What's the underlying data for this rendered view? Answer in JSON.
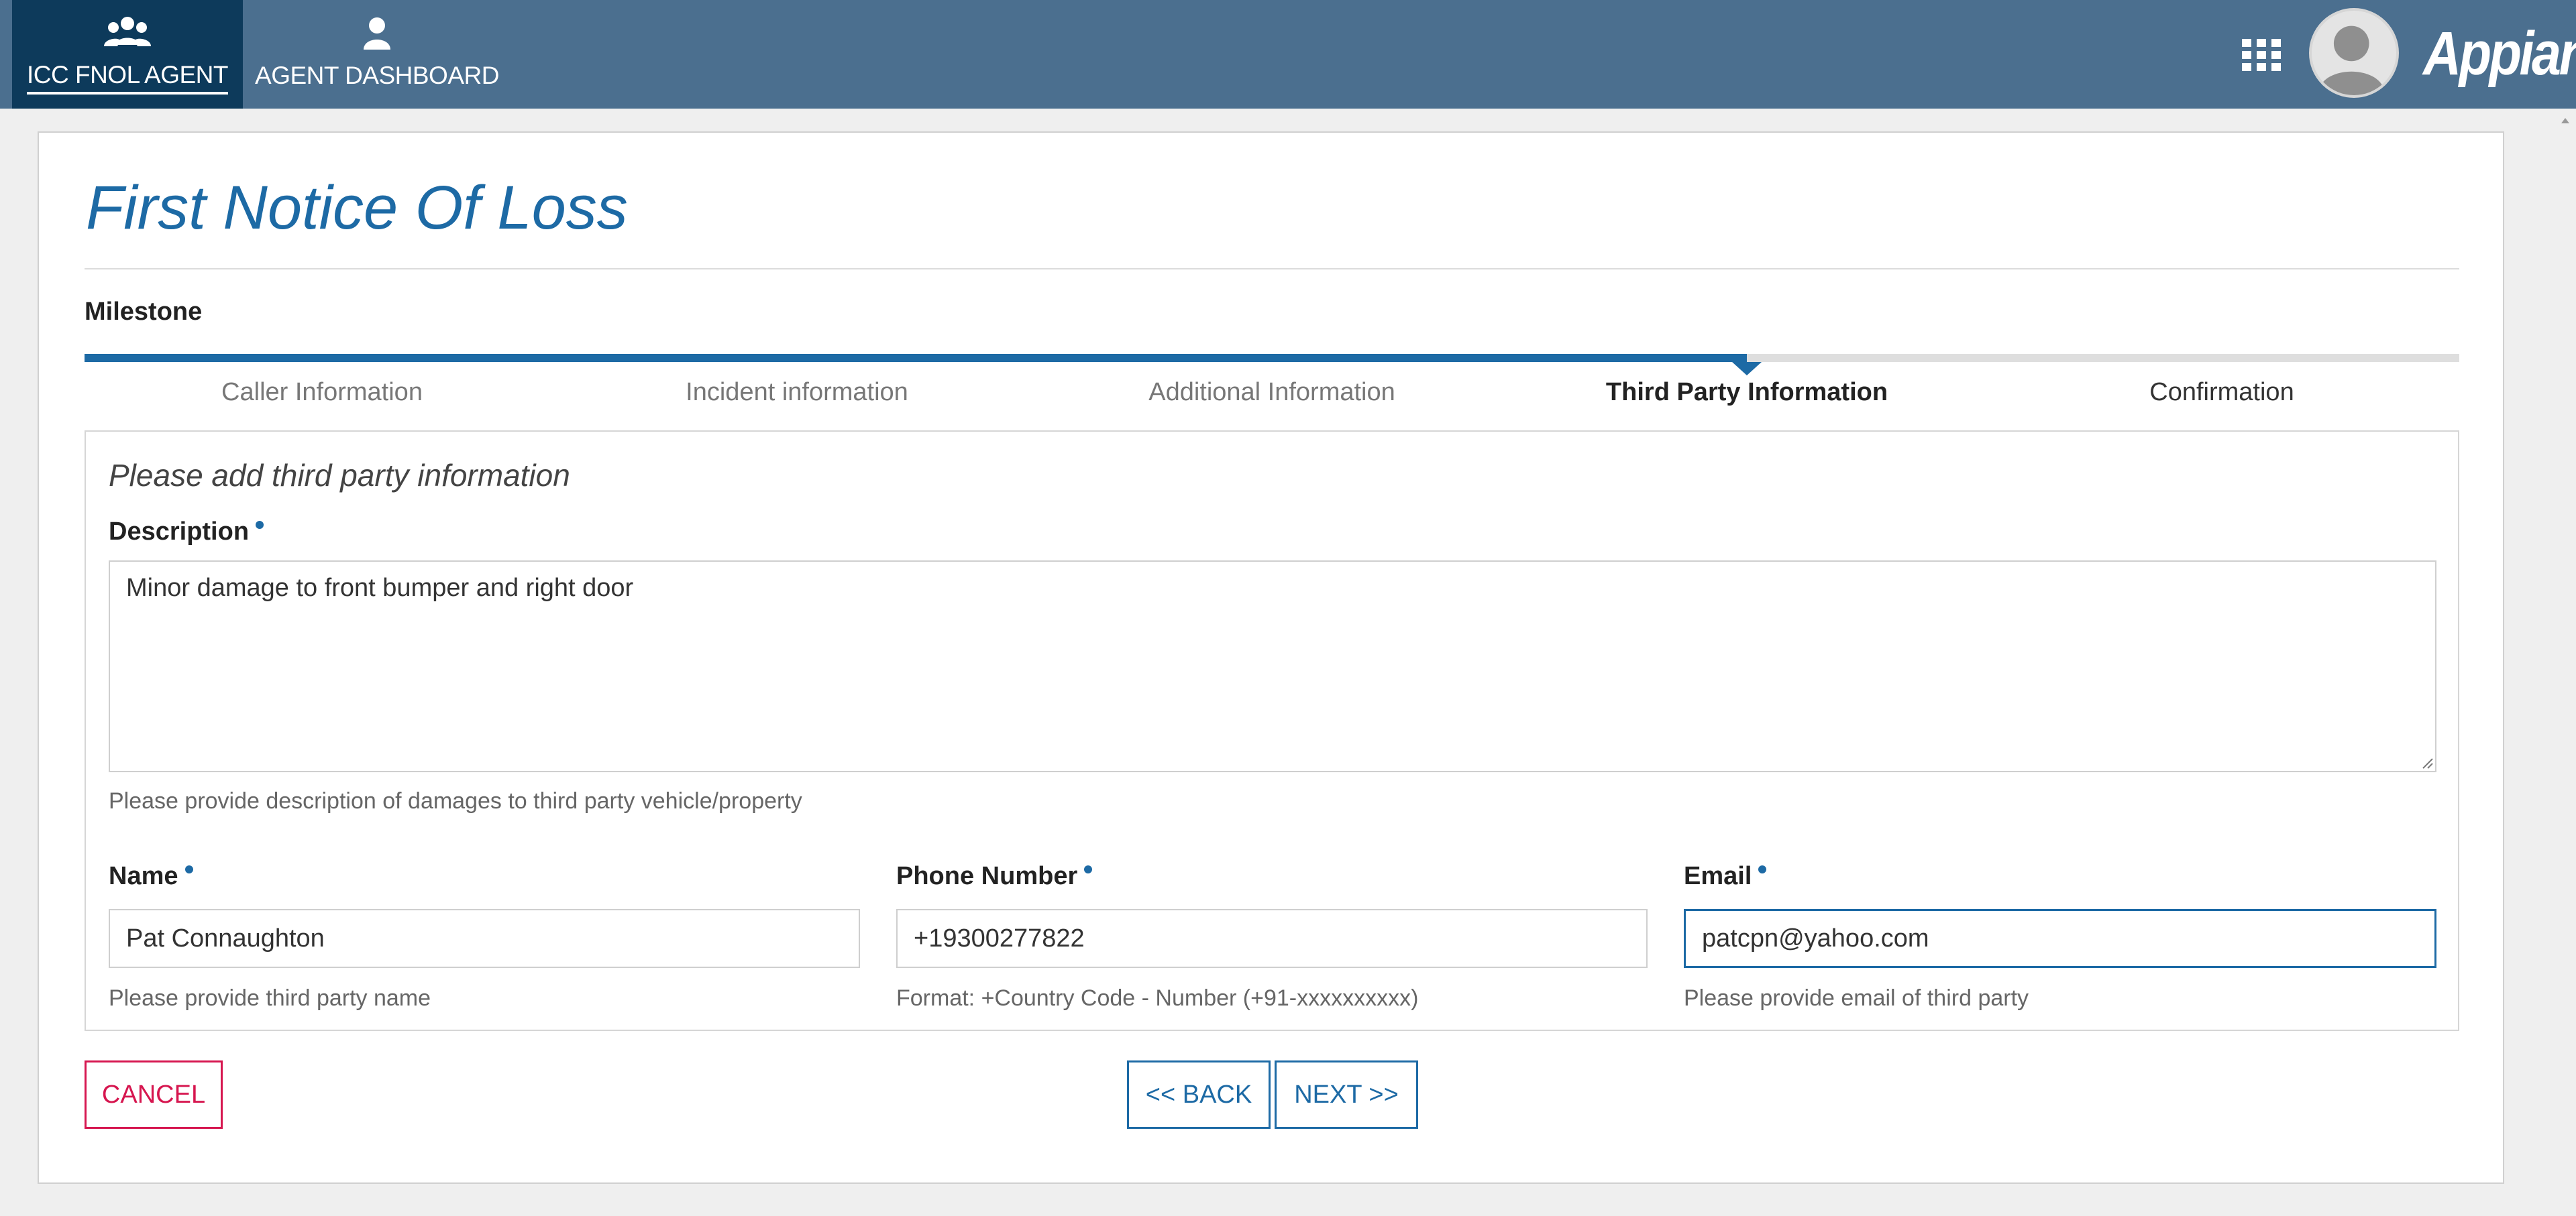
{
  "topbar": {
    "tabs": [
      {
        "label": "ICC FNOL AGENT",
        "icon": "users-group-icon",
        "active": true
      },
      {
        "label": "AGENT DASHBOARD",
        "icon": "user-icon",
        "active": false
      }
    ],
    "brand": "Appian",
    "colors": {
      "bar": "#4b6f8f",
      "active_tab": "#0d3a5b"
    }
  },
  "page": {
    "title": "First Notice Of Loss",
    "milestone_label": "Milestone",
    "steps": [
      "Caller Information",
      "Incident information",
      "Additional Information",
      "Third Party Information",
      "Confirmation"
    ],
    "current_step_index": 3,
    "progress_fraction": 0.7
  },
  "form": {
    "instruction": "Please add third party information",
    "description": {
      "label": "Description",
      "value": "Minor damage to front bumper and right door",
      "help": "Please provide description of damages to third party vehicle/property"
    },
    "name": {
      "label": "Name",
      "value": "Pat Connaughton",
      "help": "Please provide third party name"
    },
    "phone": {
      "label": "Phone Number",
      "value": "+19300277822",
      "help": "Format: +Country Code - Number (+91-xxxxxxxxxx)"
    },
    "email": {
      "label": "Email",
      "value": "patcpn@yahoo.com",
      "help": "Please provide email of third party"
    }
  },
  "buttons": {
    "cancel": "CANCEL",
    "back": "<< BACK",
    "next": "NEXT >>"
  },
  "colors": {
    "accent": "#1d6aa5",
    "cancel": "#d6164f"
  }
}
